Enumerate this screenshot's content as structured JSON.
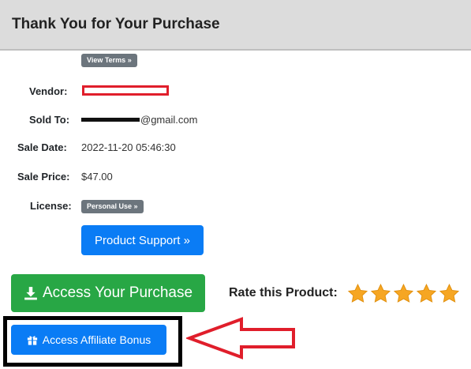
{
  "header": {
    "title": "Thank You for Your Purchase"
  },
  "details": {
    "view_terms_badge": "View Terms »",
    "vendor_label": "Vendor:",
    "sold_to_label": "Sold To:",
    "sold_to_email_suffix": "@gmail.com",
    "sale_date_label": "Sale Date:",
    "sale_date_value": "2022-11-20 05:46:30",
    "sale_price_label": "Sale Price:",
    "sale_price_value": "$47.00",
    "license_label": "License:",
    "license_badge": "Personal Use »"
  },
  "buttons": {
    "product_support": "Product Support »",
    "access_purchase": "Access Your Purchase",
    "affiliate_bonus": "Access Affiliate Bonus"
  },
  "rating": {
    "label": "Rate this Product:",
    "stars": 5,
    "star_color": "#f6a623"
  },
  "icons": {
    "access_purchase": "download-icon",
    "affiliate_bonus": "gift-icon"
  },
  "colors": {
    "header_bg": "#dcdcdc",
    "primary": "#0a7cf5",
    "success": "#28a745",
    "badge": "#6c757d",
    "annotation_red": "#e01e2b"
  }
}
